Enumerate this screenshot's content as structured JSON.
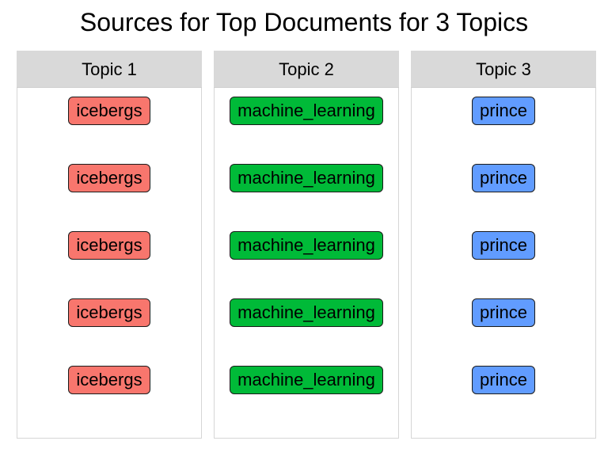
{
  "chart_data": {
    "type": "table",
    "title": "Sources for Top Documents for 3 Topics",
    "panels": [
      {
        "header": "Topic 1",
        "color": "#f8766d",
        "labels": [
          "icebergs",
          "icebergs",
          "icebergs",
          "icebergs",
          "icebergs"
        ]
      },
      {
        "header": "Topic 2",
        "color": "#00ba38",
        "labels": [
          "machine_learning",
          "machine_learning",
          "machine_learning",
          "machine_learning",
          "machine_learning"
        ]
      },
      {
        "header": "Topic 3",
        "color": "#619cff",
        "labels": [
          "prince",
          "prince",
          "prince",
          "prince",
          "prince"
        ]
      }
    ]
  }
}
